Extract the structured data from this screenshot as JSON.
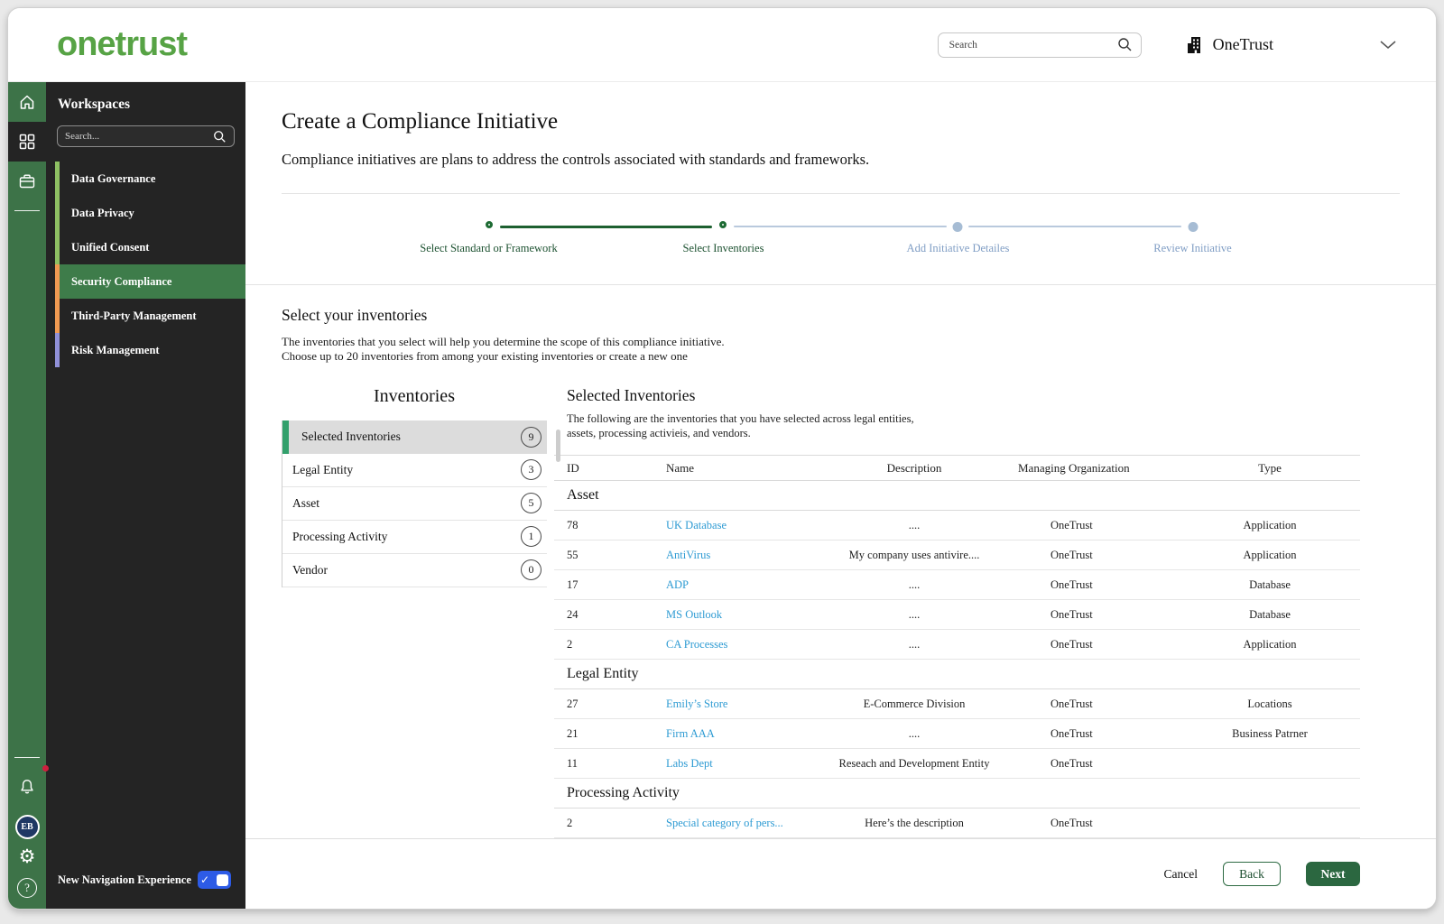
{
  "header": {
    "logo": "onetrust",
    "search_placeholder": "Search",
    "org_name": "OneTrust"
  },
  "rail": {
    "avatar_initials": "EB",
    "help_glyph": "?",
    "gear_glyph": "⚙"
  },
  "sidebar": {
    "title": "Workspaces",
    "search_placeholder": "Search...",
    "items": [
      {
        "label": "Data Governance",
        "stripe_color": "#8ec063",
        "active": false
      },
      {
        "label": "Data Privacy",
        "stripe_color": "#8ec063",
        "active": false
      },
      {
        "label": "Unified Consent",
        "stripe_color": "#8ec063",
        "active": false
      },
      {
        "label": "Security Compliance",
        "stripe_color": "#f09a52",
        "active": true
      },
      {
        "label": "Third-Party Management",
        "stripe_color": "#f09a52",
        "active": false
      },
      {
        "label": "Risk Management",
        "stripe_color": "#9090d8",
        "active": false
      }
    ],
    "footer": {
      "toggle_label": "New Navigation Experience",
      "toggle_on": true,
      "toggle_check": "✓"
    }
  },
  "wizard": {
    "title": "Create a Compliance Initiative",
    "subtitle": "Compliance initiatives are plans to address the controls associated with standards and frameworks.",
    "steps": [
      {
        "label": "Select Standard or Framework",
        "state": "complete"
      },
      {
        "label": "Select Inventories",
        "state": "active"
      },
      {
        "label": "Add Initiative Detailes",
        "state": "upcoming"
      },
      {
        "label": "Review Initiative",
        "state": "upcoming"
      }
    ]
  },
  "section": {
    "heading": "Select your inventories",
    "description_line1": "The inventories that you select will help you determine the scope of this compliance initiative.",
    "description_line2": "Choose up to 20 inventories from among your existing inventories or create a new one"
  },
  "inventories": {
    "title": "Inventories",
    "items": [
      {
        "label": "Selected Inventories",
        "count": 9,
        "active": true
      },
      {
        "label": "Legal Entity",
        "count": 3,
        "active": false
      },
      {
        "label": "Asset",
        "count": 5,
        "active": false
      },
      {
        "label": "Processing Activity",
        "count": 1,
        "active": false
      },
      {
        "label": "Vendor",
        "count": 0,
        "active": false
      }
    ]
  },
  "selected": {
    "title": "Selected Inventories",
    "description_line1": "The following are the inventories that you have selected across legal entities,",
    "description_line2": "assets, processing activieis, and vendors.",
    "columns": [
      "ID",
      "Name",
      "Description",
      "Managing Organization",
      "Type"
    ],
    "groups": [
      {
        "name": "Asset",
        "rows": [
          {
            "id": "78",
            "name": "UK Database",
            "description": "....",
            "org": "OneTrust",
            "type": "Application"
          },
          {
            "id": "55",
            "name": "AntiVirus",
            "description": "My company uses antivire....",
            "org": "OneTrust",
            "type": "Application"
          },
          {
            "id": "17",
            "name": "ADP",
            "description": "....",
            "org": "OneTrust",
            "type": "Database"
          },
          {
            "id": "24",
            "name": "MS Outlook",
            "description": "....",
            "org": "OneTrust",
            "type": "Database"
          },
          {
            "id": "2",
            "name": "CA Processes",
            "description": "....",
            "org": "OneTrust",
            "type": "Application"
          }
        ]
      },
      {
        "name": "Legal Entity",
        "rows": [
          {
            "id": "27",
            "name": "Emily’s Store",
            "description": "E-Commerce Division",
            "org": "OneTrust",
            "type": "Locations"
          },
          {
            "id": "21",
            "name": "Firm AAA",
            "description": "....",
            "org": "OneTrust",
            "type": "Business Patrner"
          },
          {
            "id": "11",
            "name": "Labs Dept",
            "description": "Reseach and Development Entity",
            "org": "OneTrust",
            "type": ""
          }
        ]
      },
      {
        "name": "Processing Activity",
        "rows": [
          {
            "id": "2",
            "name": "Special category of pers...",
            "description": "Here’s the description",
            "org": "OneTrust",
            "type": ""
          }
        ]
      }
    ]
  },
  "footer_actions": {
    "cancel": "Cancel",
    "back": "Back",
    "next": "Next"
  },
  "colors": {
    "brand_green": "#57a345",
    "rail_green": "#3d7348",
    "active_item_green": "#3e7c4a",
    "step_done_green": "#1d6b33",
    "step_todo_blue": "#a6bcd4",
    "link_blue": "#2e9bd3",
    "toggle_blue": "#2d5be6",
    "next_button_green": "#2b6740"
  }
}
